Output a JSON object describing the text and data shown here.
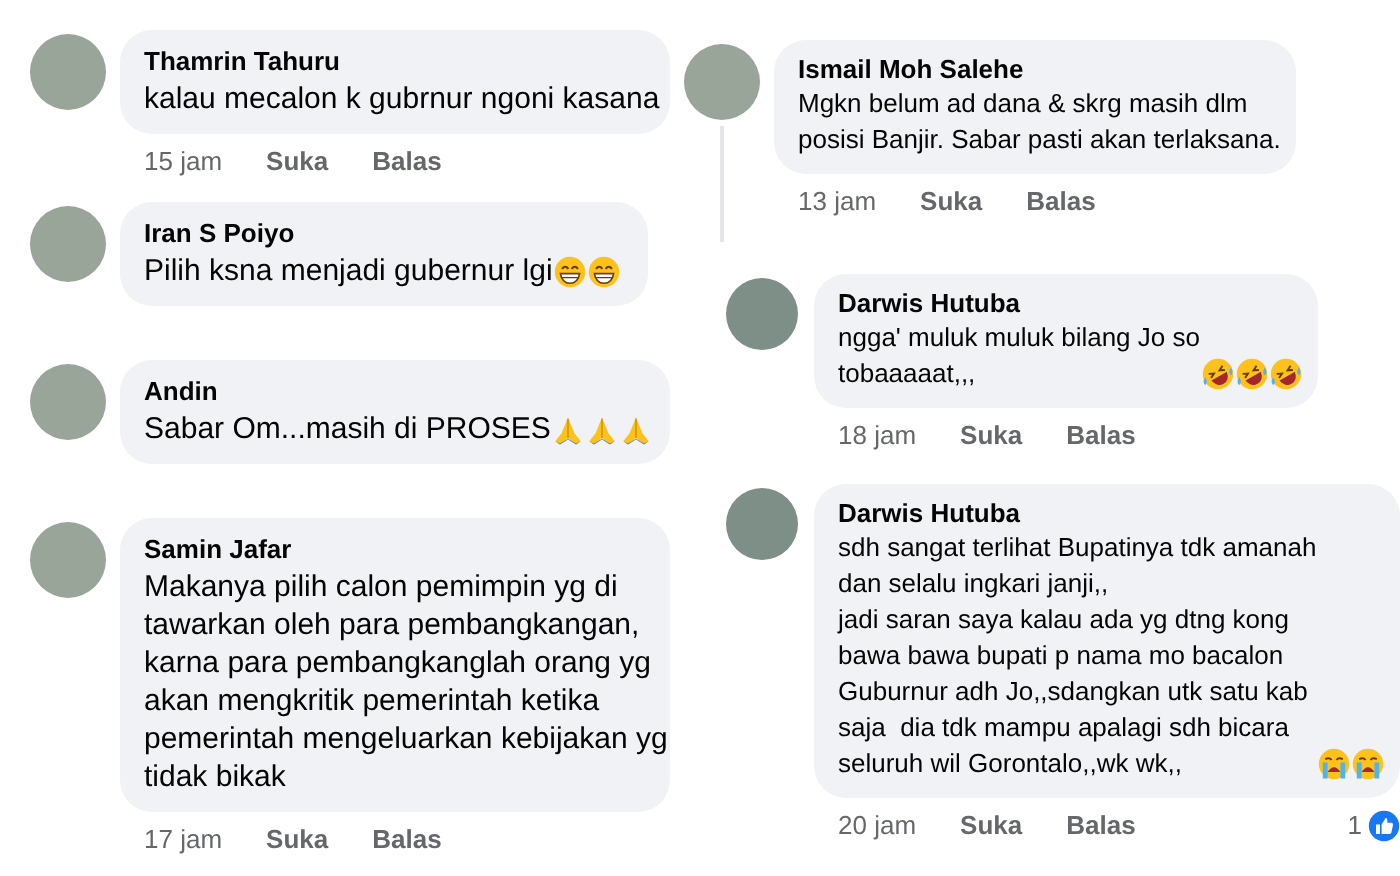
{
  "columns": [
    {
      "comments": [
        {
          "name": "Thamrin Tahuru",
          "text": "kalau mecalon k gubrnur ngoni kasana",
          "indented": false,
          "thread": false,
          "time": "15 jam",
          "like": "Suka",
          "reply": "Balas"
        },
        {
          "name": "Iran S Poiyo",
          "text": "Pilih ksna menjadi gubernur lgi",
          "emoji": [
            {
              "kind": "grin"
            },
            {
              "kind": "grin"
            }
          ],
          "indented": false,
          "thread": false
        },
        {
          "name": "Andin",
          "text": "Sabar Om...masih di PROSES",
          "emoji": [
            {
              "kind": "pray"
            },
            {
              "kind": "pray"
            },
            {
              "kind": "pray"
            }
          ],
          "indented": false,
          "thread": false
        },
        {
          "name": "Samin Jafar",
          "text": "Makanya pilih calon pemimpin yg di\ntawarkan oleh para pembangkangan,\nkarna para pembangkanglah orang yg\nakan mengkritik pemerintah ketika\npemerintah mengeluarkan kebijakan yg\ntidak bikak",
          "indented": false,
          "thread": false,
          "time": "17 jam",
          "like": "Suka",
          "reply": "Balas"
        }
      ]
    },
    {
      "comments": [
        {
          "name": "Ismail Moh Salehe",
          "text": "Mgkn belum ad dana & skrg masih dlm\nposisi Banjir. Sabar pasti akan terlaksana.",
          "indented": false,
          "thread": true,
          "time": "13 jam",
          "like": "Suka",
          "reply": "Balas"
        },
        {
          "name": "Darwis Hutuba",
          "text": "ngga' muluk muluk bilang Jo so\ntobaaaaat,,,",
          "emoji": [
            {
              "kind": "rofl"
            },
            {
              "kind": "rofl"
            },
            {
              "kind": "rofl"
            }
          ],
          "indented": true,
          "thread": false,
          "time": "18 jam",
          "like": "Suka",
          "reply": "Balas"
        },
        {
          "name": "Darwis Hutuba",
          "text": "sdh sangat terlihat Bupatinya tdk amanah\ndan selalu ingkari janji,,\njadi saran saya kalau ada yg dtng kong\nbawa bawa bupati p nama mo bacalon\nGuburnur adh Jo,,sdangkan utk satu kab\nsaja  dia tdk mampu apalagi sdh bicara\nseluruh wil Gorontalo,,wk wk,,",
          "emoji": [
            {
              "kind": "sob"
            },
            {
              "kind": "sob"
            }
          ],
          "indented": true,
          "thread": false,
          "time": "20 jam",
          "like": "Suka",
          "reply": "Balas",
          "reactions": "1"
        }
      ]
    }
  ]
}
